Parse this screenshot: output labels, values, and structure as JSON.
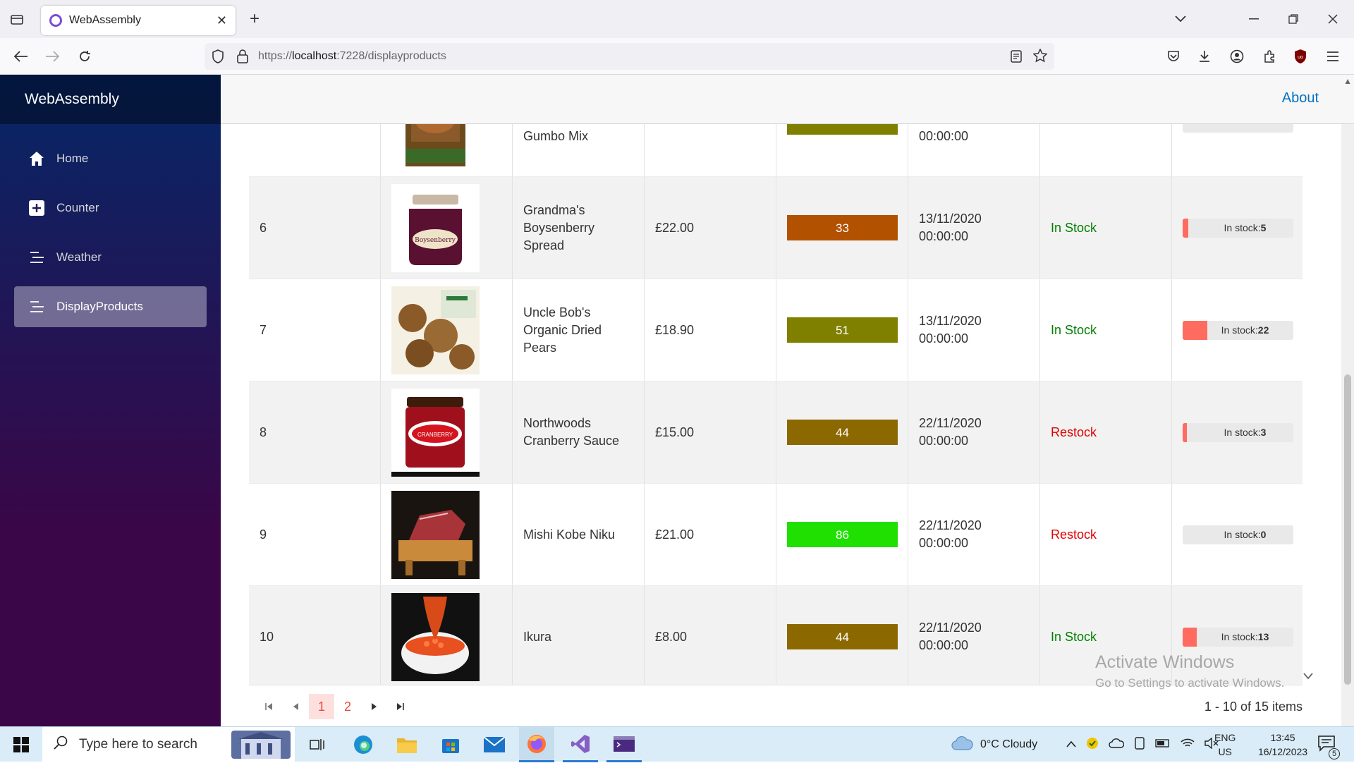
{
  "browser": {
    "tab_title": "WebAssembly",
    "url_prefix": "https://",
    "url_host": "localhost",
    "url_path": ":7228/displayproducts"
  },
  "app": {
    "brand": "WebAssembly",
    "about_link": "About",
    "nav": [
      {
        "label": "Home",
        "icon": "home-icon"
      },
      {
        "label": "Counter",
        "icon": "plus-icon"
      },
      {
        "label": "Weather",
        "icon": "list-icon"
      },
      {
        "label": "DisplayProducts",
        "icon": "list-icon"
      }
    ]
  },
  "partial_row": {
    "name": "Gumbo Mix",
    "date_time": "00:00:00"
  },
  "rows": [
    {
      "id": "6",
      "name_lines": [
        "Grandma's",
        "Boysenberry",
        "Spread"
      ],
      "price": "£22.00",
      "score": "33",
      "score_color": "#b25100",
      "date": "13/11/2020",
      "time": "00:00:00",
      "status": "In Stock",
      "status_kind": "instock",
      "stock_label": "In stock:",
      "stock": "5",
      "stock_fill": 0.05
    },
    {
      "id": "7",
      "name_lines": [
        "Uncle Bob's",
        "Organic Dried",
        "Pears"
      ],
      "price": "£18.90",
      "score": "51",
      "score_color": "#808000",
      "date": "13/11/2020",
      "time": "00:00:00",
      "status": "In Stock",
      "status_kind": "instock",
      "stock_label": "In stock:",
      "stock": "22",
      "stock_fill": 0.22
    },
    {
      "id": "8",
      "name_lines": [
        "Northwoods",
        "Cranberry Sauce"
      ],
      "price": "£15.00",
      "score": "44",
      "score_color": "#8c6800",
      "date": "22/11/2020",
      "time": "00:00:00",
      "status": "Restock",
      "status_kind": "restock",
      "stock_label": "In stock:",
      "stock": "3",
      "stock_fill": 0.03
    },
    {
      "id": "9",
      "name_lines": [
        "Mishi Kobe Niku"
      ],
      "price": "£21.00",
      "score": "86",
      "score_color": "#1fe000",
      "date": "22/11/2020",
      "time": "00:00:00",
      "status": "Restock",
      "status_kind": "restock",
      "stock_label": "In stock:",
      "stock": "0",
      "stock_fill": 0
    },
    {
      "id": "10",
      "name_lines": [
        "Ikura"
      ],
      "price": "£8.00",
      "score": "44",
      "score_color": "#8c6800",
      "date": "22/11/2020",
      "time": "00:00:00",
      "status": "In Stock",
      "status_kind": "instock",
      "stock_label": "In stock:",
      "stock": "13",
      "stock_fill": 0.13
    }
  ],
  "pager": {
    "pages": [
      "1",
      "2"
    ],
    "current": "1",
    "info": "1 - 10 of 15 items"
  },
  "watermark": {
    "title": "Activate Windows",
    "subtitle": "Go to Settings to activate Windows."
  },
  "taskbar": {
    "search_placeholder": "Type here to search",
    "weather": "0°C  Cloudy",
    "lang_top": "ENG",
    "lang_bottom": "US",
    "time": "13:45",
    "date": "16/12/2023",
    "notifications": "5"
  }
}
